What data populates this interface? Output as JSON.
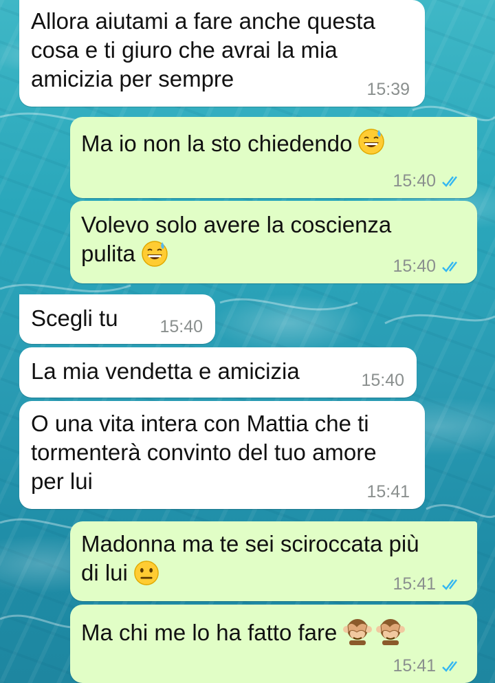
{
  "messages": [
    {
      "dir": "in",
      "text": "Allora aiutami a fare anche questa\ncosa e ti giuro che avrai la mia\namicizia per sempre",
      "time": "15:39"
    },
    {
      "dir": "out",
      "text": "Ma io non la sto chiedendo",
      "emoji": "sweat-smile",
      "time": "15:40",
      "status": "read"
    },
    {
      "dir": "out",
      "text": "Volevo solo avere la coscienza\npulita",
      "emoji": "sweat-smile",
      "time": "15:40",
      "status": "read"
    },
    {
      "dir": "in",
      "text": "Scegli tu",
      "time": "15:40"
    },
    {
      "dir": "in",
      "text": "La mia vendetta e amicizia",
      "time": "15:40"
    },
    {
      "dir": "in",
      "text": "O una vita intera con Mattia che ti\ntormenterà convinto del tuo amore\nper lui",
      "time": "15:41"
    },
    {
      "dir": "out",
      "text": "Madonna ma te sei sciroccata più\ndi lui",
      "emoji": "neutral-face",
      "time": "15:41",
      "status": "read"
    },
    {
      "dir": "out",
      "text": "Ma chi me lo ha fatto fare",
      "emoji": "see-no-evil-monkey x2",
      "time": "15:41",
      "status": "read"
    }
  ],
  "colors": {
    "incoming": "#ffffff",
    "outgoing": "#e1fec6",
    "read_check": "#34b7f1",
    "time": "#8a8f8e"
  }
}
